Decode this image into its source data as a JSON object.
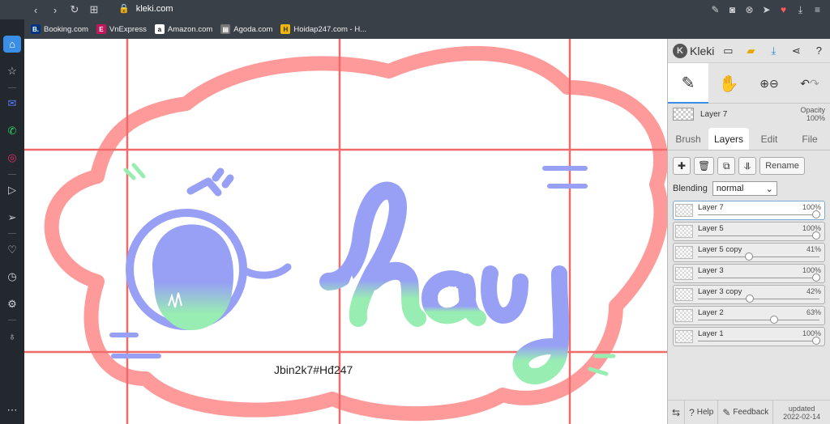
{
  "browser": {
    "url": "kleki.com",
    "bookmarks": [
      {
        "label": "Booking.com",
        "fav": "B.",
        "color": "#003580"
      },
      {
        "label": "VnExpress",
        "fav": "E",
        "color": "#c2185b"
      },
      {
        "label": "Amazon.com",
        "fav": "a",
        "color": "#111111"
      },
      {
        "label": "Agoda.com",
        "fav": "▤",
        "color": "#777777"
      },
      {
        "label": "Hoidap247.com - H...",
        "fav": "H",
        "color": "#f2b705"
      }
    ]
  },
  "canvas": {
    "watermark": "Jbin2k7#Hđ247",
    "colors": {
      "outline": "#ff9a9a",
      "grid": "#f06a6a",
      "purple": "#97a0f5",
      "green": "#98eeb2"
    }
  },
  "panel": {
    "logo": "Kleki",
    "current_layer": {
      "name": "Layer 7",
      "opacity_label": "Opacity",
      "opacity_value": "100%"
    },
    "tabs": [
      "Brush",
      "Layers",
      "Edit",
      "File"
    ],
    "active_tab": "Layers",
    "rename_label": "Rename",
    "blending_label": "Blending",
    "blending_value": "normal",
    "layers": [
      {
        "name": "Layer 7",
        "opacity": "100%",
        "value": 1.0,
        "active": true
      },
      {
        "name": "Layer 5",
        "opacity": "100%",
        "value": 1.0,
        "active": false
      },
      {
        "name": "Layer 5 copy",
        "opacity": "41%",
        "value": 0.41,
        "active": false
      },
      {
        "name": "Layer 3",
        "opacity": "100%",
        "value": 1.0,
        "active": false
      },
      {
        "name": "Layer 3 copy",
        "opacity": "42%",
        "value": 0.42,
        "active": false
      },
      {
        "name": "Layer 2",
        "opacity": "63%",
        "value": 0.63,
        "active": false
      },
      {
        "name": "Layer 1",
        "opacity": "100%",
        "value": 1.0,
        "active": false
      }
    ],
    "footer": {
      "help": "Help",
      "feedback": "Feedback",
      "updated_label": "updated",
      "updated_date": "2022-02-14"
    }
  }
}
